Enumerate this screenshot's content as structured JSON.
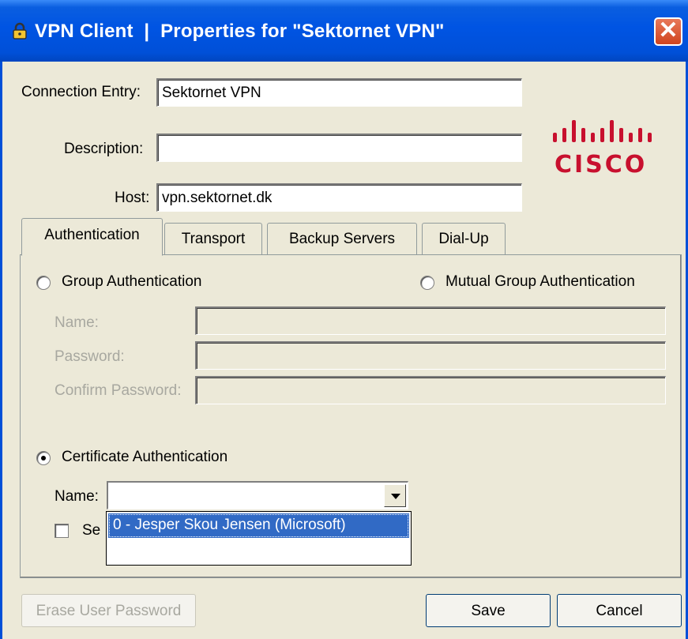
{
  "window": {
    "title": "VPN Client  |  Properties for \"Sektornet VPN\"",
    "close_symbol": "✕"
  },
  "form": {
    "connection_entry": {
      "label": "Connection Entry:",
      "value": "Sektornet VPN"
    },
    "description": {
      "label": "Description:",
      "value": ""
    },
    "host": {
      "label": "Host:",
      "value": "vpn.sektornet.dk"
    }
  },
  "logo": {
    "text": "CISCO",
    "color": "#C8102E",
    "icon": "cisco-logo"
  },
  "tabs": [
    {
      "label": "Authentication",
      "active": true
    },
    {
      "label": "Transport",
      "active": false
    },
    {
      "label": "Backup Servers",
      "active": false
    },
    {
      "label": "Dial-Up",
      "active": false
    }
  ],
  "auth": {
    "group_auth_label": "Group Authentication",
    "group_auth_selected": false,
    "mutual_group_auth_label": "Mutual Group Authentication",
    "mutual_group_auth_selected": false,
    "name_label": "Name:",
    "password_label": "Password:",
    "confirm_password_label": "Confirm Password:",
    "cert_auth_label": "Certificate Authentication",
    "cert_auth_selected": true,
    "cert_name_label": "Name:",
    "cert_name_value": "",
    "cert_dropdown_options": [
      "0 - Jesper Skou Jensen (Microsoft)"
    ],
    "checkbox_partial_label": "Se"
  },
  "buttons": {
    "erase_password": "Erase User Password",
    "save": "Save",
    "cancel": "Cancel"
  },
  "colors": {
    "titlebar": "#0054E3",
    "dialog_bg": "#ECE9D8",
    "selection": "#316AC5",
    "close_button": "#D0441E"
  }
}
